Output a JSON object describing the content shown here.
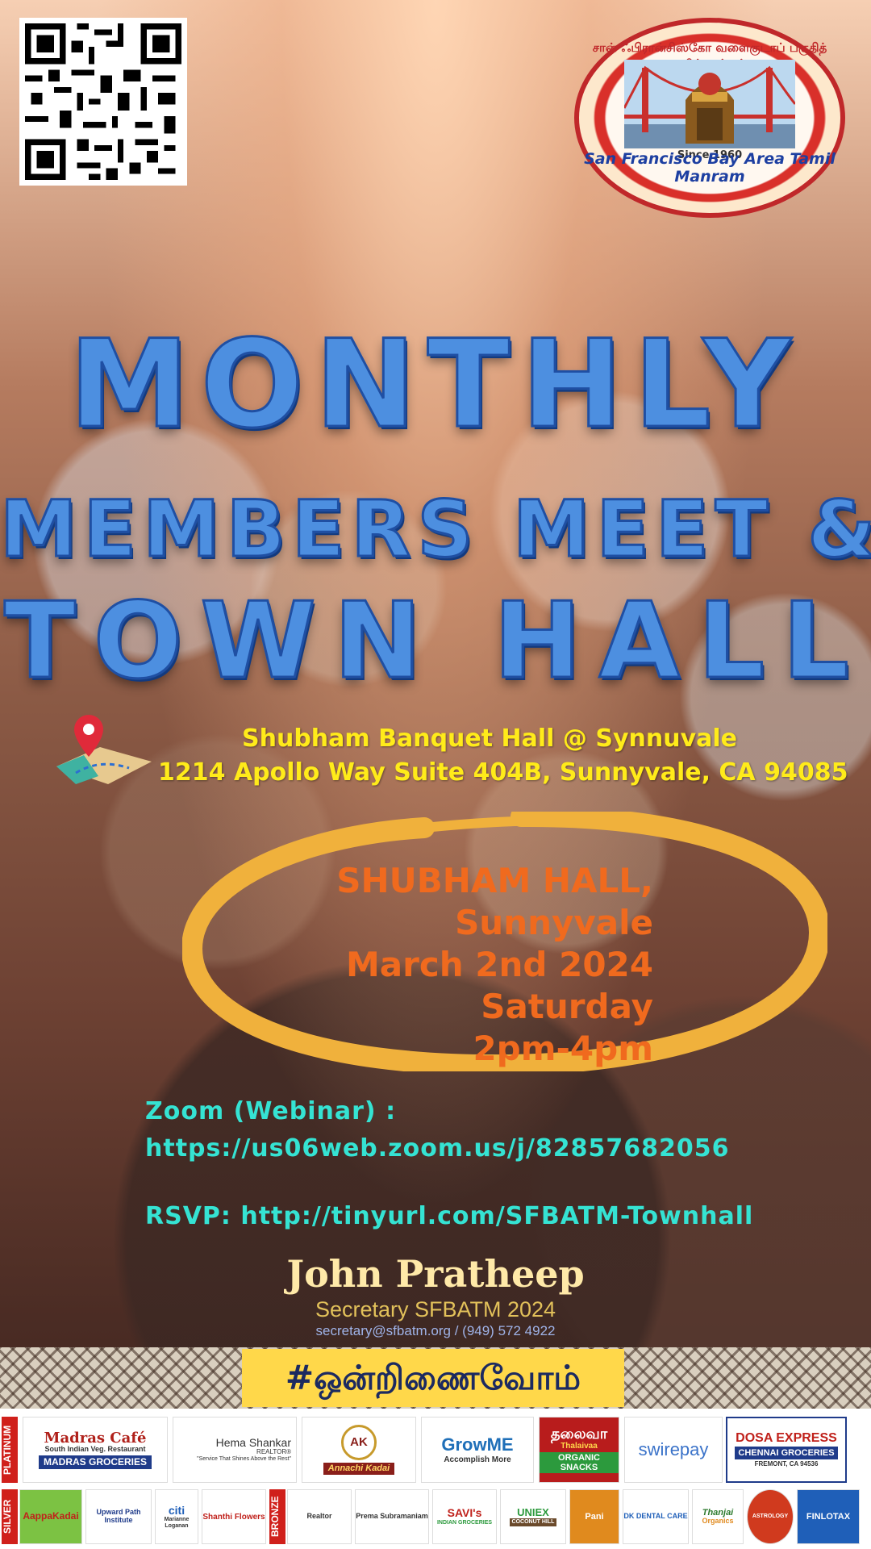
{
  "header": {
    "logo": {
      "tamil_ring_text": "சான் ஃபிரான்சிஸ்கோ வளைகுடாப் பகுதித் தமிழ் மன்றம்",
      "english_ring_text": "San Francisco Bay Area Tamil Manram",
      "since": "Since 1960"
    }
  },
  "title": {
    "line1": "MONTHLY",
    "line2": "MEMBERS MEET &",
    "line3": "TOWN HALL"
  },
  "venue": {
    "line1": "Shubham Banquet Hall @ Synnuvale",
    "line2": "1214 Apollo Way Suite 404B, Sunnyvale, CA 94085"
  },
  "event": {
    "hall": "SHUBHAM HALL,",
    "city": "Sunnyvale",
    "date": "March 2nd 2024",
    "day": "Saturday",
    "time": "2pm-4pm"
  },
  "links": {
    "zoom_label": "Zoom (Webinar) :",
    "zoom_url": "https://us06web.zoom.us/j/82857682056",
    "rsvp": "RSVP: http://tinyurl.com/SFBATM-Townhall"
  },
  "signature": {
    "name": "John Pratheep",
    "role": "Secretary SFBATM 2024",
    "contact": "secretary@sfbatm.org / (949) 572 4922"
  },
  "hashtag": "#ஒன்றிணைவோம்",
  "sponsors": {
    "platinum_label": "PLATINUM",
    "silver_label": "SILVER",
    "bronze_label": "BRONZE",
    "platinum": [
      {
        "name": "Madras Café",
        "sub": "South Indian Veg. Restaurant",
        "extra": "MADRAS GROCERIES"
      },
      {
        "name": "Hema Shankar",
        "sub": "REALTOR®",
        "extra": "\"Service That Shines Above the Rest\""
      },
      {
        "name": "Annachi Kadai",
        "sub": "AK"
      },
      {
        "name": "GrowME",
        "sub": "Accomplish More"
      },
      {
        "name": "தலைவா",
        "sub": "Thalaivaa",
        "extra": "ORGANIC SNACKS"
      },
      {
        "name": "swirepay"
      },
      {
        "name": "DOSA EXPRESS",
        "sub": "CHENNAI GROCERIES",
        "extra": "FREMONT, CA 94536"
      }
    ],
    "silver": [
      {
        "name": "AappaKadai"
      },
      {
        "name": "Upward Path Institute"
      },
      {
        "name": "citi",
        "sub": "Marianne Loganan"
      },
      {
        "name": "Shanthi Flowers"
      }
    ],
    "bronze": [
      {
        "name": "Realtor"
      },
      {
        "name": "Prema Subramaniam"
      },
      {
        "name": "SAVI's",
        "sub": "INDIAN GROCERIES"
      },
      {
        "name": "UNIEX",
        "sub": "COCONUT HILL"
      },
      {
        "name": "Pani"
      },
      {
        "name": "DK DENTAL CARE"
      },
      {
        "name": "Thanjai",
        "sub": "Organics"
      },
      {
        "name": "ASTROLOGY"
      },
      {
        "name": "FINLOTAX"
      }
    ]
  },
  "colors": {
    "title_blue": "#4d8fe0",
    "address_yellow": "#ffeb1a",
    "event_orange": "#f06a1e",
    "zoom_teal": "#35e3d3",
    "ring_gold": "#f0b13c",
    "hashtag_bg": "#ffd84a"
  }
}
